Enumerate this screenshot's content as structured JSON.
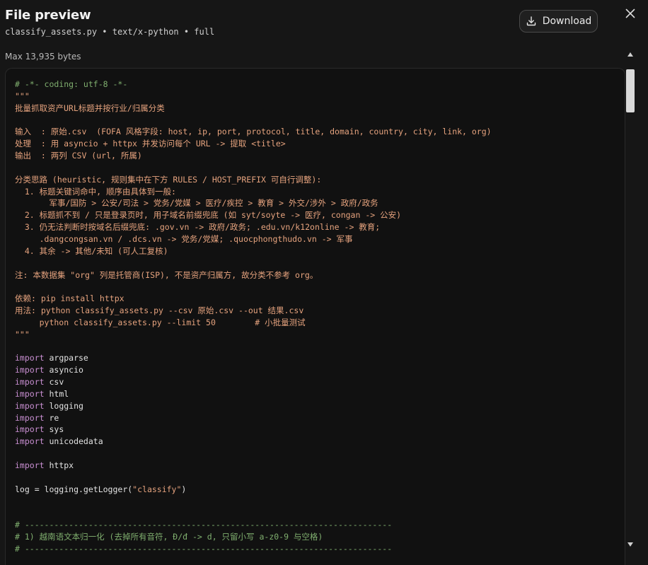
{
  "header": {
    "title": "File preview",
    "subtitle": "classify_assets.py • text/x-python • full",
    "max_bytes": "Max 13,935 bytes",
    "download_label": "Download",
    "download_icon": "download-icon",
    "close_icon": "close-icon"
  },
  "code": {
    "lines": [
      {
        "type": "comment",
        "text": "# -*- coding: utf-8 -*-"
      },
      {
        "type": "docstr",
        "text": "\"\"\""
      },
      {
        "type": "docstr",
        "text": "批量抓取资产URL标题并按行业/归属分类"
      },
      {
        "type": "docstr",
        "text": ""
      },
      {
        "type": "docstr",
        "text": "输入  : 原始.csv  (FOFA 风格字段: host, ip, port, protocol, title, domain, country, city, link, org)"
      },
      {
        "type": "docstr",
        "text": "处理  : 用 asyncio + httpx 并发访问每个 URL -> 提取 <title>"
      },
      {
        "type": "docstr",
        "text": "输出  : 两列 CSV (url, 所属)"
      },
      {
        "type": "docstr",
        "text": ""
      },
      {
        "type": "docstr",
        "text": "分类思路 (heuristic, 规则集中在下方 RULES / HOST_PREFIX 可自行调整):"
      },
      {
        "type": "docstr",
        "text": "  1. 标题关键词命中, 顺序由具体到一般:"
      },
      {
        "type": "docstr",
        "text": "       军事/国防 > 公安/司法 > 党务/党媒 > 医疗/疾控 > 教育 > 外交/涉外 > 政府/政务"
      },
      {
        "type": "docstr",
        "text": "  2. 标题抓不到 / 只是登录页时, 用子域名前缀兜底 (如 syt/soyte -> 医疗, congan -> 公安)"
      },
      {
        "type": "docstr",
        "text": "  3. 仍无法判断时按域名后缀兜底: .gov.vn -> 政府/政务; .edu.vn/k12online -> 教育;"
      },
      {
        "type": "docstr",
        "text": "     .dangcongsan.vn / .dcs.vn -> 党务/党媒; .quocphongthudo.vn -> 军事"
      },
      {
        "type": "docstr",
        "text": "  4. 其余 -> 其他/未知 (可人工复核)"
      },
      {
        "type": "docstr",
        "text": ""
      },
      {
        "type": "docstr",
        "text": "注: 本数据集 \"org\" 列是托管商(ISP), 不是资产归属方, 故分类不参考 org。"
      },
      {
        "type": "docstr",
        "text": ""
      },
      {
        "type": "docstr",
        "text": "依赖: pip install httpx"
      },
      {
        "type": "docstr",
        "text": "用法: python classify_assets.py --csv 原始.csv --out 结果.csv"
      },
      {
        "type": "docstr",
        "text": "     python classify_assets.py --limit 50        # 小批量测试"
      },
      {
        "type": "docstr",
        "text": "\"\"\""
      },
      {
        "type": "plain",
        "text": ""
      },
      {
        "type": "import",
        "kw": "import",
        "text": " argparse"
      },
      {
        "type": "import",
        "kw": "import",
        "text": " asyncio"
      },
      {
        "type": "import",
        "kw": "import",
        "text": " csv"
      },
      {
        "type": "import",
        "kw": "import",
        "text": " html"
      },
      {
        "type": "import",
        "kw": "import",
        "text": " logging"
      },
      {
        "type": "import",
        "kw": "import",
        "text": " re"
      },
      {
        "type": "import",
        "kw": "import",
        "text": " sys"
      },
      {
        "type": "import",
        "kw": "import",
        "text": " unicodedata"
      },
      {
        "type": "plain",
        "text": ""
      },
      {
        "type": "import",
        "kw": "import",
        "text": " httpx"
      },
      {
        "type": "plain",
        "text": ""
      },
      {
        "type": "call",
        "pre": "log = logging.getLogger(",
        "str": "\"classify\"",
        "post": ")"
      },
      {
        "type": "plain",
        "text": ""
      },
      {
        "type": "plain",
        "text": ""
      },
      {
        "type": "comment",
        "text": "# ---------------------------------------------------------------------------"
      },
      {
        "type": "comment",
        "text": "# 1) 越南语文本归一化 (去掉所有音符, Đ/đ -> d, 只留小写 a-z0-9 与空格)"
      },
      {
        "type": "comment",
        "text": "# ---------------------------------------------------------------------------"
      }
    ]
  },
  "scrollbar": {
    "up_icon": "chevron-up-icon",
    "down_icon": "chevron-down-icon"
  }
}
